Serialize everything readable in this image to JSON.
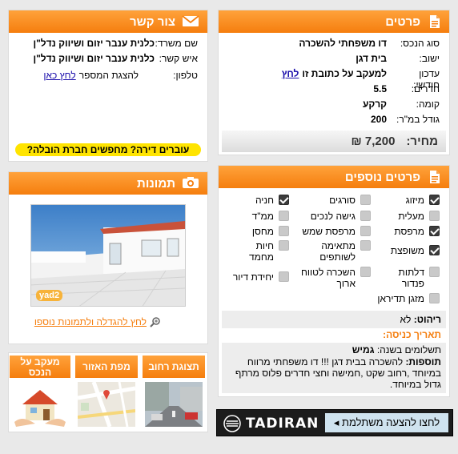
{
  "details": {
    "title": "פרטים",
    "rows": [
      {
        "label": "סוג הנכס:",
        "value": "דו משפחתי להשכרה"
      },
      {
        "label": "ישוב:",
        "value": "בית דגן"
      },
      {
        "label": "עדכון חודשי:",
        "value": "למעקב על כתובת זו",
        "link": "לחץ"
      },
      {
        "label": "חדרים:",
        "value": "5.5"
      },
      {
        "label": "קומה:",
        "value": "קרקע"
      },
      {
        "label": "גודל במ\"ר:",
        "value": "200"
      }
    ],
    "price_label": "מחיר:",
    "price_value": "7,200 ₪"
  },
  "contact": {
    "title": "צור קשר",
    "rows": [
      {
        "label": "שם משרד:",
        "value": "כלנית ענבר יזום ושיווק נדל\"ן"
      },
      {
        "label": "איש קשר:",
        "value": "כלנית ענבר יזום ושיווק נדל\"ן"
      },
      {
        "label": "טלפון:",
        "value": "להצגת המספר",
        "link": "לחץ כאן"
      }
    ],
    "banner": "עוברים דירה? מחפשים חברת הובלה?"
  },
  "photos": {
    "title": "תמונות",
    "watermark": "yad2",
    "enlarge_link": "לחץ להגדלה ולתמונות נוספו"
  },
  "extra": {
    "title": "פרטים נוספים",
    "features": [
      {
        "label": "מיזוג",
        "checked": true
      },
      {
        "label": "סורגים",
        "checked": false
      },
      {
        "label": "חניה",
        "checked": true
      },
      {
        "label": "מעלית",
        "checked": false
      },
      {
        "label": "גישה לנכים",
        "checked": false
      },
      {
        "label": "ממ\"ד",
        "checked": false
      },
      {
        "label": "מרפסת",
        "checked": true
      },
      {
        "label": "מרפסת שמש",
        "checked": false
      },
      {
        "label": "מחסן",
        "checked": false
      },
      {
        "label": "משופצת",
        "checked": true
      },
      {
        "label": "מתאימה לשותפים",
        "checked": false
      },
      {
        "label": "חיות מחמד",
        "checked": false
      },
      {
        "label": "דלתות פנדור",
        "checked": false
      },
      {
        "label": "השכרה לטווח ארוך",
        "checked": false
      },
      {
        "label": "יחידת דיור",
        "checked": false
      },
      {
        "label": "מזגן תדיראן",
        "checked": false
      }
    ],
    "furniture_label": "ריהוט:",
    "furniture_value": "לא",
    "entry_label": "תאריך כניסה:",
    "payments_label": "תשלומים בשנה:",
    "payments_value": "גמיש",
    "additions_label": "תוספות:",
    "additions_value": "להשכרה בבית דגן !!! דו משפחתי מרווח במיוחד ,רחוב שקט ,חמישה וחצי חדרים פלוס מרתף גדול במיוחד."
  },
  "tabs": {
    "street": "תצוגת רחוב",
    "map": "מפת האזור",
    "tracking": "מעקב על הנכס"
  },
  "ad": {
    "cta": "לחצו להצעה משתלמת",
    "brand": "TADIRAN"
  },
  "colors": {
    "accent": "#f57e0e",
    "banner": "#ffe400",
    "ad_bg": "#1c1c1c"
  }
}
